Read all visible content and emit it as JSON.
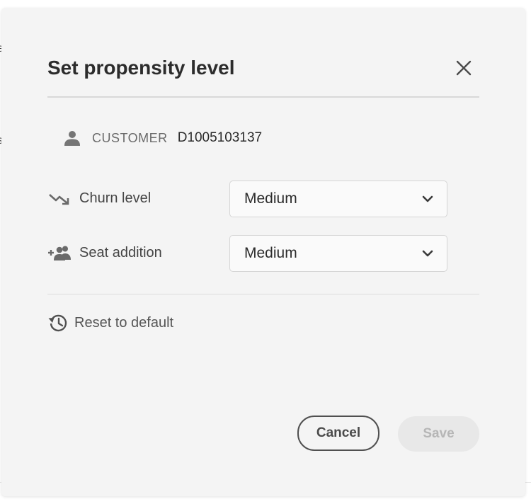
{
  "background": {
    "fragment_top": "e",
    "fragment_mid": "s"
  },
  "dialog": {
    "title": "Set propensity level",
    "close_icon": "close-icon",
    "customer": {
      "icon": "person-icon",
      "label": "CUSTOMER",
      "id": "D1005103137"
    },
    "fields": [
      {
        "icon": "trending-down-icon",
        "label": "Churn level",
        "value": "Medium"
      },
      {
        "icon": "add-people-icon",
        "label": "Seat addition",
        "value": "Medium"
      }
    ],
    "reset": {
      "icon": "history-icon",
      "label": "Reset to default"
    },
    "buttons": {
      "cancel": "Cancel",
      "save": "Save",
      "save_disabled": true
    }
  },
  "colors": {
    "dialog_bg": "#f4f4f4",
    "text_primary": "#2c2c2c",
    "disabled_bg": "#e8e8e8",
    "disabled_text": "#b6b6b6"
  }
}
